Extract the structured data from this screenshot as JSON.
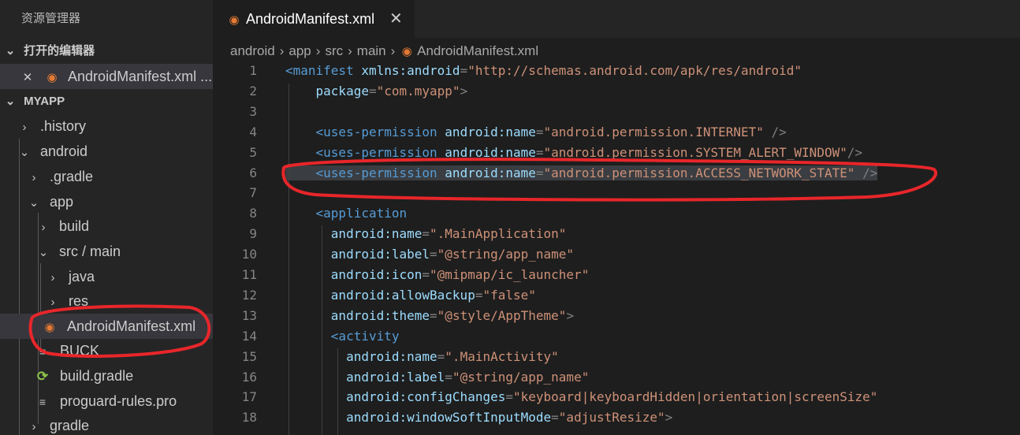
{
  "sidebar": {
    "title": "资源管理器",
    "open_editors_label": "打开的编辑器",
    "open_editor_file": "AndroidManifest.xml ...",
    "project_label": "MYAPP",
    "tree": [
      ".history",
      "android",
      ".gradle",
      "app",
      "build",
      "src / main",
      "java",
      "res",
      "AndroidManifest.xml",
      "BUCK",
      "build.gradle",
      "proguard-rules.pro",
      "gradle"
    ]
  },
  "tab": {
    "label": "AndroidManifest.xml",
    "close": "✕"
  },
  "breadcrumb": [
    "android",
    "app",
    "src",
    "main",
    "AndroidManifest.xml"
  ],
  "editor": {
    "line_numbers": [
      "1",
      "2",
      "3",
      "4",
      "5",
      "6",
      "7",
      "8",
      "9",
      "10",
      "11",
      "12",
      "13",
      "14",
      "15",
      "16",
      "17",
      "18"
    ],
    "lines": [
      [
        [
          "tg",
          "<manifest "
        ],
        [
          "at",
          "xmlns:android"
        ],
        [
          "pun",
          "="
        ],
        [
          "str",
          "\"http://schemas.android.com/apk/res/android\""
        ]
      ],
      [
        [
          "at",
          "    package"
        ],
        [
          "pun",
          "="
        ],
        [
          "str",
          "\"com.myapp\""
        ],
        [
          "pun",
          ">"
        ]
      ],
      [],
      [
        [
          "tg",
          "    <uses-permission "
        ],
        [
          "at",
          "android:name"
        ],
        [
          "pun",
          "="
        ],
        [
          "str",
          "\"android.permission.INTERNET\""
        ],
        [
          "pun",
          " />"
        ]
      ],
      [
        [
          "tg",
          "    <uses-permission "
        ],
        [
          "at",
          "android:name"
        ],
        [
          "pun",
          "="
        ],
        [
          "str",
          "\"android.permission.SYSTEM_ALERT_WINDOW\""
        ],
        [
          "pun",
          "/>"
        ]
      ],
      [
        [
          "tg",
          "    <uses-permission "
        ],
        [
          "at",
          "android:name"
        ],
        [
          "pun",
          "="
        ],
        [
          "str",
          "\"android.permission.ACCESS_NETWORK_STATE\""
        ],
        [
          "pun",
          " />"
        ]
      ],
      [],
      [
        [
          "tg",
          "    <application"
        ]
      ],
      [
        [
          "at",
          "      android:name"
        ],
        [
          "pun",
          "="
        ],
        [
          "str",
          "\".MainApplication\""
        ]
      ],
      [
        [
          "at",
          "      android:label"
        ],
        [
          "pun",
          "="
        ],
        [
          "str",
          "\"@string/app_name\""
        ]
      ],
      [
        [
          "at",
          "      android:icon"
        ],
        [
          "pun",
          "="
        ],
        [
          "str",
          "\"@mipmap/ic_launcher\""
        ]
      ],
      [
        [
          "at",
          "      android:allowBackup"
        ],
        [
          "pun",
          "="
        ],
        [
          "str",
          "\"false\""
        ]
      ],
      [
        [
          "at",
          "      android:theme"
        ],
        [
          "pun",
          "="
        ],
        [
          "str",
          "\"@style/AppTheme\""
        ],
        [
          "pun",
          ">"
        ]
      ],
      [
        [
          "tg",
          "      <activity"
        ]
      ],
      [
        [
          "at",
          "        android:name"
        ],
        [
          "pun",
          "="
        ],
        [
          "str",
          "\".MainActivity\""
        ]
      ],
      [
        [
          "at",
          "        android:label"
        ],
        [
          "pun",
          "="
        ],
        [
          "str",
          "\"@string/app_name\""
        ]
      ],
      [
        [
          "at",
          "        android:configChanges"
        ],
        [
          "pun",
          "="
        ],
        [
          "str",
          "\"keyboard|keyboardHidden|orientation|screenSize\""
        ]
      ],
      [
        [
          "at",
          "        android:windowSoftInputMode"
        ],
        [
          "pun",
          "="
        ],
        [
          "str",
          "\"adjustResize\""
        ],
        [
          "pun",
          ">"
        ]
      ]
    ]
  },
  "colors": {
    "annotation": "#e8262a",
    "tag": "#569cd6",
    "attr": "#9cdcfe",
    "string": "#ce9178",
    "xml_icon": "#e37933",
    "gradle_icon": "#8dc149"
  }
}
